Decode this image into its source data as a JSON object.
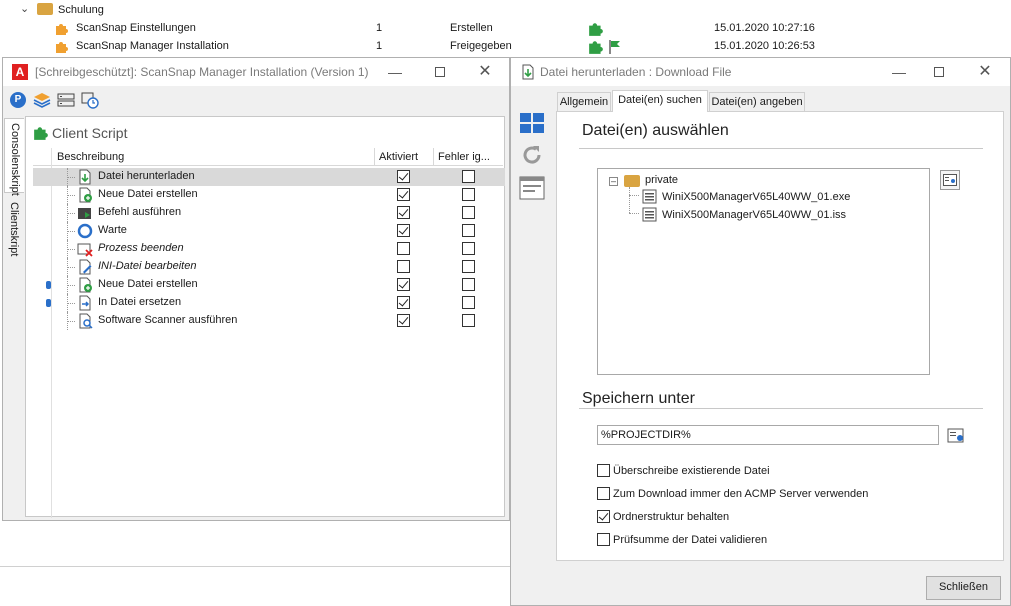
{
  "background_tree": {
    "folder_label": "Schulung",
    "rows": [
      {
        "name": "ScanSnap Einstellungen",
        "count": "1",
        "status": "Erstellen",
        "date": "15.01.2020 10:27:16"
      },
      {
        "name": "ScanSnap Manager Installation",
        "count": "1",
        "status": "Freigegeben",
        "date": "15.01.2020 10:26:53"
      }
    ]
  },
  "left_window": {
    "title": "[Schreibgeschützt]: ScanSnap Manager Installation (Version 1)",
    "side_tabs": [
      "Consolenskript",
      "Clientskript"
    ],
    "section_title": "Client Script",
    "columns": [
      "Beschreibung",
      "Aktiviert",
      "Fehler ig..."
    ],
    "rows": [
      {
        "label": "Datei herunterladen",
        "aktiviert": true,
        "fehler": false,
        "italic": false,
        "icon": "download-file-icon"
      },
      {
        "label": "Neue Datei erstellen",
        "aktiviert": true,
        "fehler": false,
        "italic": false,
        "icon": "new-file-icon"
      },
      {
        "label": "Befehl ausführen",
        "aktiviert": true,
        "fehler": false,
        "italic": false,
        "icon": "run-command-icon"
      },
      {
        "label": "Warte",
        "aktiviert": true,
        "fehler": false,
        "italic": false,
        "icon": "wait-icon"
      },
      {
        "label": "Prozess beenden",
        "aktiviert": false,
        "fehler": false,
        "italic": true,
        "icon": "kill-process-icon"
      },
      {
        "label": "INI-Datei bearbeiten",
        "aktiviert": false,
        "fehler": false,
        "italic": true,
        "icon": "edit-ini-icon"
      },
      {
        "label": "Neue Datei erstellen",
        "aktiviert": true,
        "fehler": false,
        "italic": false,
        "icon": "new-file-icon"
      },
      {
        "label": "In Datei ersetzen",
        "aktiviert": true,
        "fehler": false,
        "italic": false,
        "icon": "replace-in-file-icon"
      },
      {
        "label": "Software Scanner ausführen",
        "aktiviert": true,
        "fehler": false,
        "italic": false,
        "icon": "software-scanner-icon"
      }
    ]
  },
  "right_window": {
    "title": "Datei herunterladen : Download File",
    "tabs": [
      "Allgemein",
      "Datei(en) suchen",
      "Datei(en) angeben"
    ],
    "active_tab": 1,
    "select_heading": "Datei(en) auswählen",
    "tree": {
      "folder": "private",
      "files": [
        "WiniX500ManagerV65L40WW_01.exe",
        "WiniX500ManagerV65L40WW_01.iss"
      ]
    },
    "save_heading": "Speichern unter",
    "save_path": "%PROJECTDIR%",
    "options": [
      {
        "label": "Überschreibe existierende Datei",
        "checked": false
      },
      {
        "label": "Zum Download immer den ACMP Server verwenden",
        "checked": false
      },
      {
        "label": "Ordnerstruktur behalten",
        "checked": true
      },
      {
        "label": "Prüfsumme der Datei validieren",
        "checked": false
      }
    ],
    "close_button": "Schließen"
  },
  "colors": {
    "accent_red": "#e02020",
    "puzzle_green": "#2f9e44",
    "puzzle_orange": "#f0a030",
    "blue_icon": "#2a6fc9"
  }
}
